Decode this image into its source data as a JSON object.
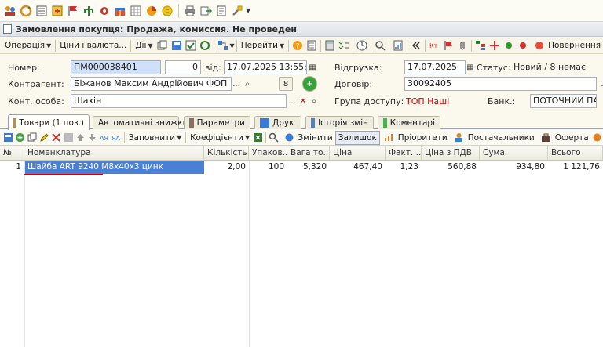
{
  "app_toolbar": {
    "icons": [
      "users-icon",
      "refresh-icon",
      "list-icon",
      "settings-icon",
      "flag-icon",
      "tree-icon",
      "gear-icon",
      "gift-icon",
      "grid-icon",
      "chart-icon",
      "money-icon",
      "printer-icon",
      "export-icon",
      "document-icon",
      "tools-icon"
    ]
  },
  "doc": {
    "title": "Замовлення покупця: Продажа, комиссия. Не проведен"
  },
  "commands": {
    "operation": "Операція",
    "prices": "Ціни і валюта...",
    "actions": "Дії",
    "goto": "Перейти",
    "repeated": "Повернення"
  },
  "form": {
    "number_label": "Номер:",
    "number_value": "ПМ000038401",
    "extra_value": "0",
    "from_label": "від:",
    "date_value": "17.07.2025 13:55:35",
    "shipment_label": "Відгрузка:",
    "shipment_value": "17.07.2025",
    "status_label": "Статус:",
    "status_value": "Новий / 8 немає",
    "contractor_label": "Контрагент:",
    "contractor_value": "Біжанов Максим Андрійович ФОП",
    "count_value": "8",
    "contract_label": "Договір:",
    "contract_value": "30092405",
    "contact_label": "Конт. особа:",
    "contact_value": "Шахін",
    "access_label": "Група доступу:",
    "access_value": "ТОП Наші",
    "bank_label": "Банк.:",
    "bank_value": "ПОТОЧНИЙ ПАТ"
  },
  "tabs": [
    {
      "label": "Товари (1 поз.)"
    },
    {
      "label": "Автоматичні знижки"
    },
    {
      "label": "Параметри"
    },
    {
      "label": "Друк"
    },
    {
      "label": "Історія змін"
    },
    {
      "label": "Коментарі"
    }
  ],
  "grid_toolbar": {
    "fill": "Заповнити",
    "coefficients": "Коефіцієнти",
    "change": "Змінити",
    "balance": "Залишок",
    "priorities": "Пріоритети",
    "suppliers": "Постачальники",
    "offer": "Оферта"
  },
  "table": {
    "columns": [
      "№",
      "Номенклатура",
      "Кількість",
      "Упаков...",
      "Вага то...",
      "Ціна",
      "Факт. ...",
      "Ціна з ПДВ",
      "Сума",
      "Всього"
    ],
    "rows": [
      {
        "n": "1",
        "name": "Шайба ART 9240 M8x40x3 цинк",
        "qty": "2,00",
        "pack": "100",
        "weight": "5,320",
        "price": "467,40",
        "fact": "1,23",
        "price_vat": "560,88",
        "sum": "934,80",
        "total": "1 121,76"
      }
    ]
  }
}
